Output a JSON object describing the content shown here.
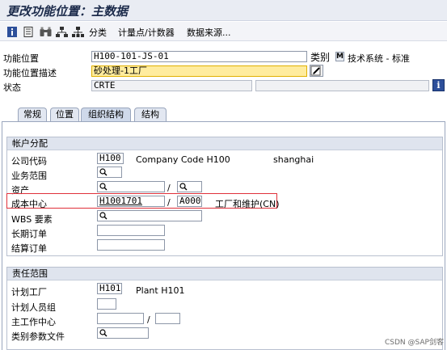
{
  "window": {
    "title": "更改功能位置：主数据"
  },
  "toolbar": {
    "classify_label": "分类",
    "measuring_points_label": "计量点/计数器",
    "data_origin_label": "数据来源..."
  },
  "header": {
    "func_loc_label": "功能位置",
    "func_loc_value": "H100-101-JS-01",
    "category_label": "类别",
    "category_code": "M",
    "category_text": "技术系统 - 标准",
    "desc_label": "功能位置描述",
    "desc_value": "砂处理-1工厂",
    "status_label": "状态",
    "status_value": "CRTE"
  },
  "tabs": [
    {
      "label": "常规"
    },
    {
      "label": "位置"
    },
    {
      "label": "组织结构"
    },
    {
      "label": "结构"
    }
  ],
  "account": {
    "title": "帐户分配",
    "company_code_label": "公司代码",
    "company_code_value": "H100",
    "company_code_text": "Company Code H100",
    "company_city": "shanghai",
    "business_area_label": "业务范围",
    "asset_label": "资产",
    "slash": "/",
    "cost_center_label": "成本中心",
    "cost_center_value": "H1001701",
    "cost_center_area": "A000",
    "cost_center_text": "工厂和维护(CN)",
    "wbs_label": "WBS 要素",
    "standing_order_label": "长期订单",
    "settlement_order_label": "结算订单"
  },
  "responsibility": {
    "title": "责任范围",
    "plant_label": "计划工厂",
    "plant_value": "H101",
    "plant_text": "Plant H101",
    "planner_group_label": "计划人员组",
    "work_center_label": "主工作中心",
    "slash": "/",
    "catalog_profile_label": "类别参数文件"
  },
  "watermark": "CSDN @SAP剑客"
}
